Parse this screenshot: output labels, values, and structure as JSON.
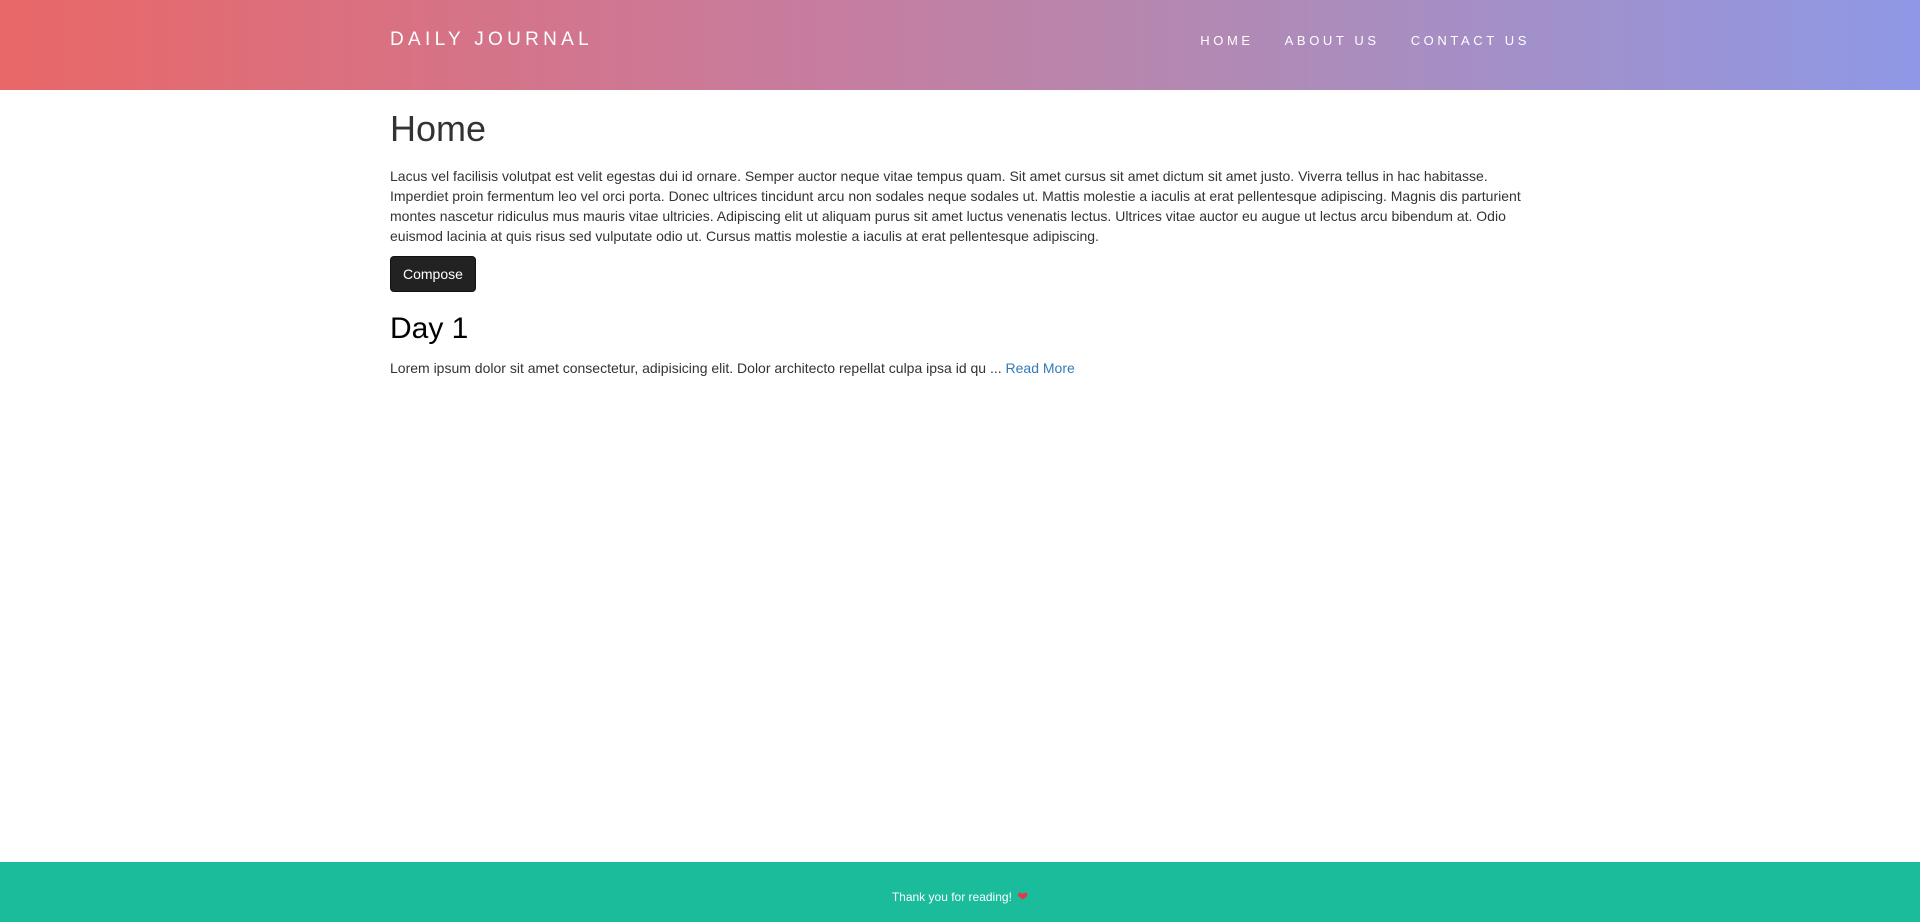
{
  "header": {
    "brand": "DAILY JOURNAL",
    "nav": [
      {
        "label": "HOME"
      },
      {
        "label": "ABOUT US"
      },
      {
        "label": "CONTACT US"
      }
    ]
  },
  "main": {
    "title": "Home",
    "intro": "Lacus vel facilisis volutpat est velit egestas dui id ornare. Semper auctor neque vitae tempus quam. Sit amet cursus sit amet dictum sit amet justo. Viverra tellus in hac habitasse. Imperdiet proin fermentum leo vel orci porta. Donec ultrices tincidunt arcu non sodales neque sodales ut. Mattis molestie a iaculis at erat pellentesque adipiscing. Magnis dis parturient montes nascetur ridiculus mus mauris vitae ultricies. Adipiscing elit ut aliquam purus sit amet luctus venenatis lectus. Ultrices vitae auctor eu augue ut lectus arcu bibendum at. Odio euismod lacinia at quis risus sed vulputate odio ut. Cursus mattis molestie a iaculis at erat pellentesque adipiscing.",
    "compose_label": "Compose",
    "posts": [
      {
        "title": "Day 1",
        "excerpt": "Lorem ipsum dolor sit amet consectetur, adipisicing elit. Dolor architecto repellat culpa ipsa id qu ...",
        "read_more": "Read More"
      }
    ]
  },
  "footer": {
    "text": "Thank you for reading!",
    "icon": "heart-icon",
    "icon_color": "#e8374a"
  },
  "colors": {
    "header_gradient_start": "#e96767",
    "header_gradient_end": "#8f98e6",
    "footer_bg": "#1abc9c",
    "button_bg": "#222222",
    "link": "#337ab7"
  }
}
